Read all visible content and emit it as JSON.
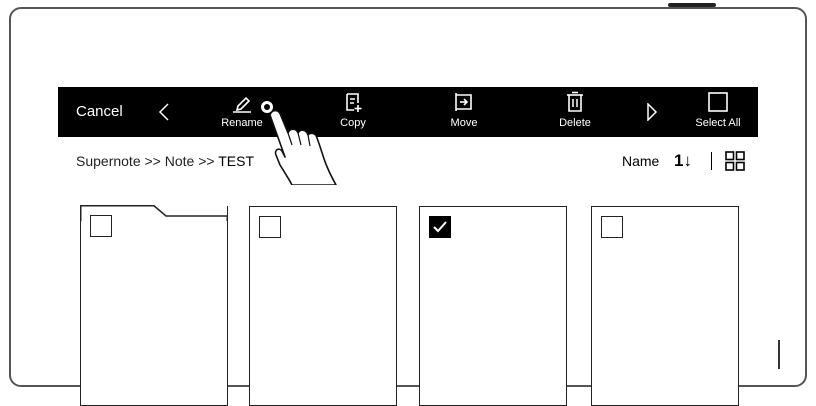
{
  "toolbar": {
    "cancel_label": "Cancel",
    "rename_label": "Rename",
    "copy_label": "Copy",
    "move_label": "Move",
    "delete_label": "Delete",
    "select_all_label": "Select All"
  },
  "path_bar": {
    "root": "Supernote",
    "separator": ">>",
    "folder": "Note",
    "current": "TEST",
    "sort_label": "Name"
  },
  "files": [
    {
      "type": "folder",
      "checked": false
    },
    {
      "type": "note",
      "checked": false
    },
    {
      "type": "note",
      "checked": true
    },
    {
      "type": "note",
      "checked": false
    }
  ],
  "icons": [
    "chevron-left-icon",
    "pencil-icon",
    "copy-icon",
    "move-icon",
    "trash-icon",
    "chevron-right-icon",
    "checkbox-icon",
    "sort-icon",
    "grid-view-icon",
    "checkmark-icon",
    "hand-pointer-icon"
  ]
}
